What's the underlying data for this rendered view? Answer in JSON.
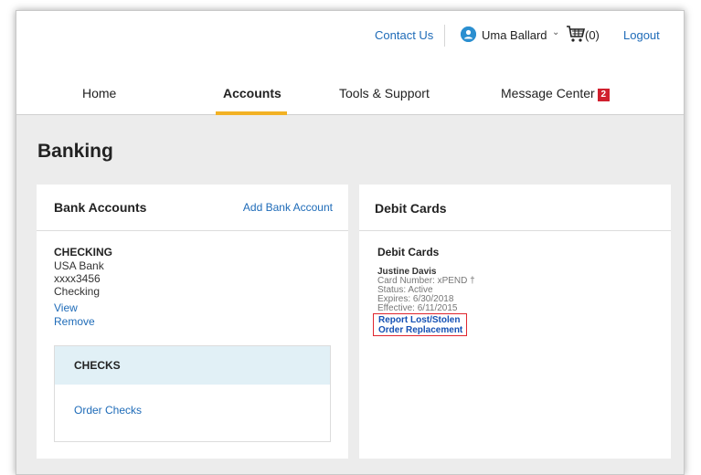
{
  "header": {
    "contact_label": "Contact Us",
    "user_initial": "•",
    "user_name": "Uma Ballard",
    "cart_count": "(0)",
    "logout_label": "Logout"
  },
  "nav": {
    "tabs": [
      {
        "label": "Home"
      },
      {
        "label": "Accounts"
      },
      {
        "label": "Tools & Support"
      },
      {
        "label": "Message Center",
        "badge": "2"
      }
    ],
    "active_color": "#f2b124"
  },
  "page": {
    "title": "Banking"
  },
  "bank_accounts": {
    "title": "Bank Accounts",
    "add_label": "Add Bank Account",
    "account": {
      "type": "CHECKING",
      "bank": "USA Bank",
      "number": "xxxx3456",
      "kind": "Checking",
      "view_label": "View",
      "remove_label": "Remove"
    },
    "checks": {
      "title": "CHECKS",
      "order_label": "Order Checks"
    }
  },
  "debit_cards": {
    "title": "Debit Cards",
    "subtitle": "Debit Cards",
    "holder": "Justine Davis",
    "card_number": "Card Number: xPEND †",
    "status": "Status: Active",
    "expires": "Expires: 6/30/2018",
    "effective": "Effective: 6/11/2015",
    "report_label": "Report Lost/Stolen",
    "replace_label": "Order Replacement"
  },
  "colors": {
    "link": "#1e6bb8",
    "badge": "#d0202e",
    "highlight_border": "#e0262e",
    "checks_header_bg": "#e1f0f6"
  }
}
